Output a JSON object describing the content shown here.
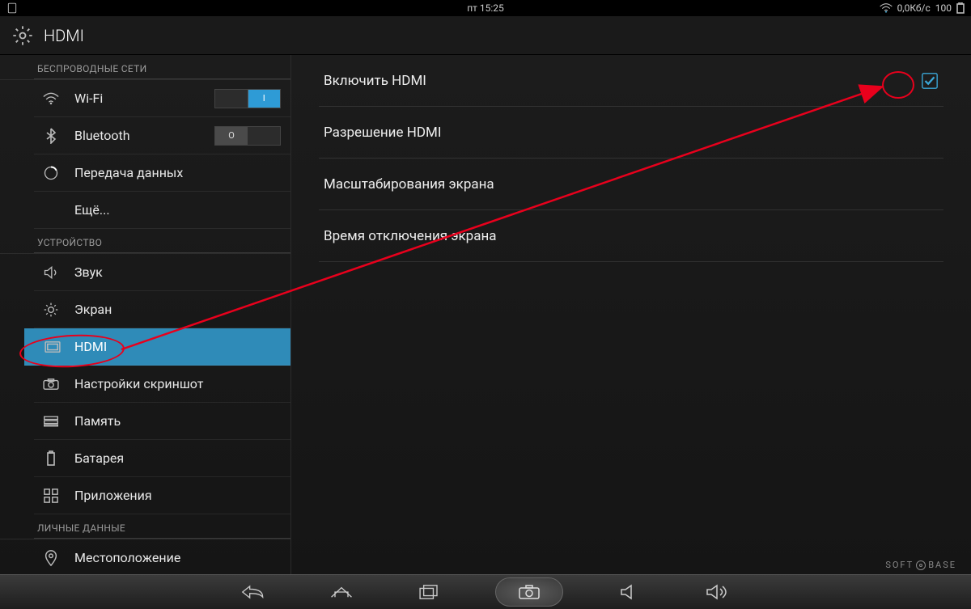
{
  "status": {
    "day_time": "пт 15:25",
    "data_rate": "0,0Кб/с",
    "battery": "100"
  },
  "header": {
    "title": "HDMI"
  },
  "sidebar": {
    "section_wireless": "БЕСПРОВОДНЫЕ СЕТИ",
    "section_device": "УСТРОЙСТВО",
    "section_personal": "ЛИЧНЫЕ ДАННЫЕ",
    "items": {
      "wifi": {
        "label": "Wi-Fi",
        "toggle_on": "I",
        "toggle_off": ""
      },
      "bluetooth": {
        "label": "Bluetooth",
        "toggle_on": "",
        "toggle_off": "O"
      },
      "data": {
        "label": "Передача данных"
      },
      "more": {
        "label": "Ещё..."
      },
      "sound": {
        "label": "Звук"
      },
      "display": {
        "label": "Экран"
      },
      "hdmi": {
        "label": "HDMI"
      },
      "screenshot": {
        "label": "Настройки скриншот"
      },
      "storage": {
        "label": "Память"
      },
      "battery": {
        "label": "Батарея"
      },
      "apps": {
        "label": "Приложения"
      },
      "location": {
        "label": "Местоположение"
      }
    }
  },
  "main": {
    "rows": {
      "enable": "Включить HDMI",
      "resolution": "Разрешение HDMI",
      "scaling": "Масштабирования экрана",
      "timeout": "Время отключения экрана"
    }
  },
  "watermark": {
    "left": "SOFT",
    "right": "BASE"
  }
}
